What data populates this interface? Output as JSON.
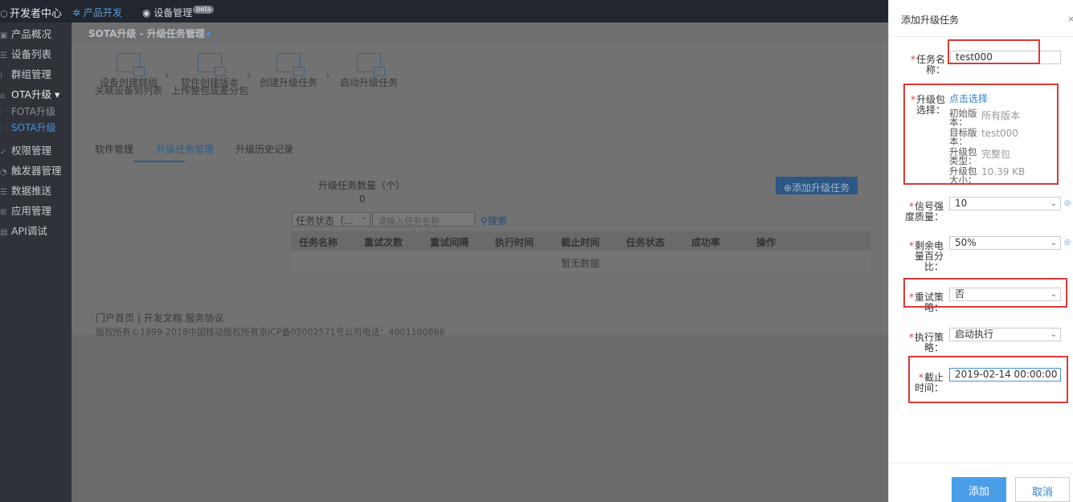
{
  "topbar": {
    "brand": "开发者中心",
    "nav_product": "产品开发",
    "nav_device": "设备管理",
    "beta": "beta"
  },
  "sidebar": {
    "items": [
      {
        "label": "产品概况",
        "icon": "product-icon"
      },
      {
        "label": "设备列表",
        "icon": "list-icon"
      },
      {
        "label": "群组管理",
        "icon": "group-icon"
      },
      {
        "label": "OTA升级",
        "icon": "ota-icon"
      },
      {
        "label": "FOTA升级",
        "icon": "dot"
      },
      {
        "label": "SOTA升级",
        "icon": "dot"
      },
      {
        "label": "权限管理",
        "icon": "permission-icon"
      },
      {
        "label": "触发器管理",
        "icon": "trigger-icon"
      },
      {
        "label": "数据推送",
        "icon": "push-icon"
      },
      {
        "label": "应用管理",
        "icon": "app-icon"
      },
      {
        "label": "API调试",
        "icon": "api-icon"
      }
    ]
  },
  "breadcrumb": "SOTA升级 - 升级任务管理",
  "steps": [
    {
      "line1": "设备创建群组",
      "line2": "关联设备到列表"
    },
    {
      "line1": "软件创建版本",
      "line2": "上传整包或差分包"
    },
    {
      "line1": "创建升级任务",
      "line2": ""
    },
    {
      "line1": "启动升级任务",
      "line2": ""
    }
  ],
  "tabs": [
    "软件管理",
    "升级任务管理",
    "升级历史记录"
  ],
  "task_count_label": "升级任务数量（个）",
  "task_count": "0",
  "add_task_button": "添加升级任务",
  "filter_status": "任务状态（...",
  "search_placeholder": "请输入任务名称",
  "search_button": "搜索",
  "table": {
    "headers": [
      "任务名称",
      "重试次数",
      "重试间隔",
      "执行时间",
      "截止时间",
      "任务状态",
      "成功率",
      "操作"
    ],
    "empty": "暂无数据"
  },
  "footer": {
    "links": "门户首页 | 开发文档   服务协议",
    "copyright": "版权所有©1999-2018中国移动版权所有京ICP备05002571号公司电话：4001100866"
  },
  "drawer": {
    "title": "添加升级任务",
    "fields": {
      "task_name": {
        "label": "任务名称：",
        "value": "test000"
      },
      "package": {
        "label": "升级包选择：",
        "link": "点击选择",
        "init_version_k": "初始版本：",
        "init_version_v": "所有版本",
        "target_version_k": "目标版本：",
        "target_version_v": "test000",
        "type_k": "升级包类型：",
        "type_v": "完整包",
        "size_k": "升级包大小：",
        "size_v": "10.39 KB"
      },
      "signal": {
        "label": "信号强度质量：",
        "value": "10"
      },
      "battery": {
        "label": "剩余电量百分比：",
        "value": "50%"
      },
      "retry": {
        "label": "重试策略：",
        "value": "否"
      },
      "execute": {
        "label": "执行策略：",
        "value": "启动执行"
      },
      "deadline": {
        "label": "截止时间：",
        "value": "2019-02-14 00:00:00"
      }
    },
    "add_button": "添加",
    "cancel_button": "取消"
  },
  "colors": {
    "accent": "#4a9ee8",
    "highlight": "#d93a3a",
    "required": "#e03a3a"
  }
}
